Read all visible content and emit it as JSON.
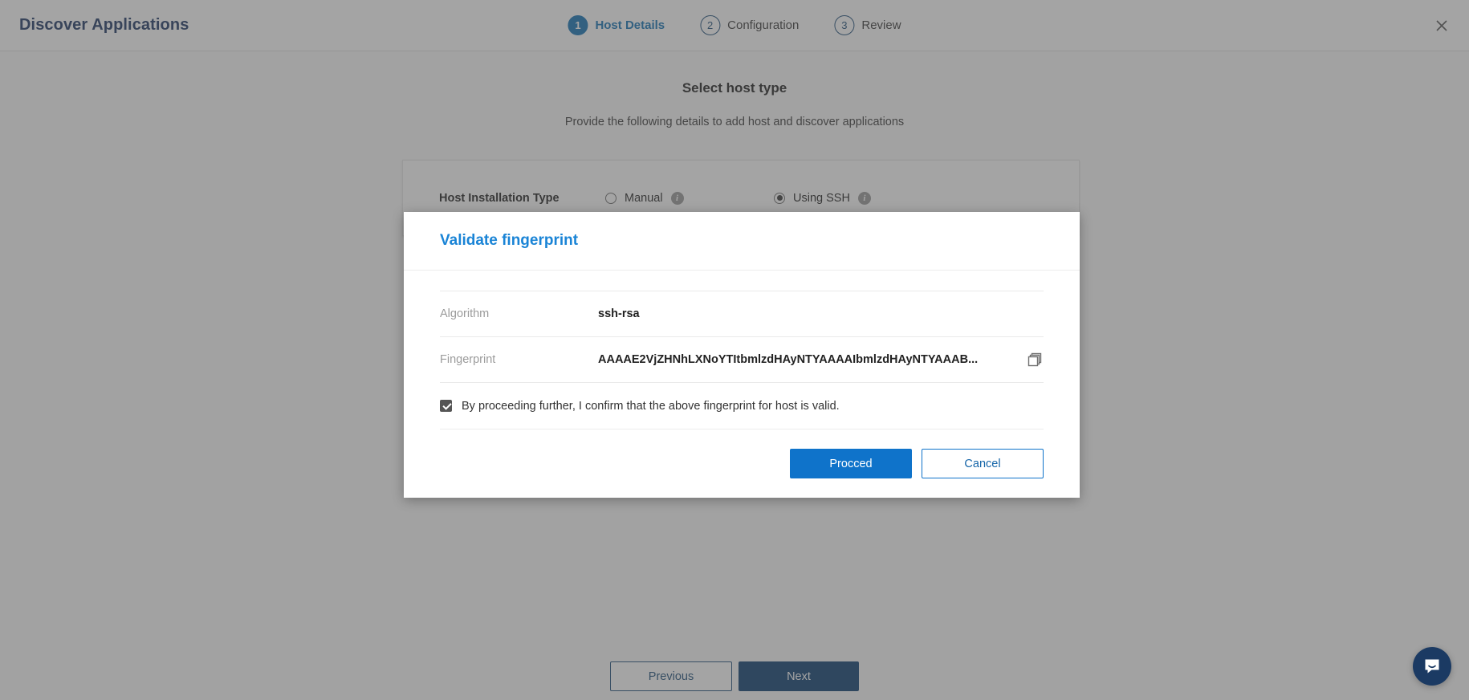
{
  "appbar": {
    "title": "Discover Applications",
    "close_icon": "close-icon",
    "steps": [
      {
        "number": "1",
        "label": "Host Details",
        "state": "active"
      },
      {
        "number": "2",
        "label": "Configuration",
        "state": "idle"
      },
      {
        "number": "3",
        "label": "Review",
        "state": "idle"
      }
    ]
  },
  "page": {
    "title": "Select host type",
    "subtitle": "Provide the following details to add host and discover applications",
    "host_card": {
      "label": "Host Installation Type",
      "options": [
        {
          "label": "Manual",
          "selected": false,
          "info_icon": "info-icon"
        },
        {
          "label": "Using SSH",
          "selected": true,
          "info_icon": "info-icon"
        }
      ]
    },
    "nav": {
      "previous_label": "Previous",
      "next_label": "Next"
    },
    "chat_icon": "chat-bubble-icon"
  },
  "modal": {
    "title": "Validate fingerprint",
    "rows": [
      {
        "label": "Algorithm",
        "value": "ssh-rsa"
      },
      {
        "label": "Fingerprint",
        "value": "AAAAE2VjZHNhLXNoYTItbmlzdHAyNTYAAAAIbmlzdHAyNTYAAAB..."
      }
    ],
    "copy_icon": "copy-icon",
    "confirm": {
      "checked": true,
      "text": "By proceeding further, I confirm that the above fingerprint for host is valid."
    },
    "proceed_label": "Procced",
    "cancel_label": "Cancel"
  },
  "colors": {
    "brand_dark": "#1f3864",
    "accent_blue": "#0f73ca",
    "step_active": "#1271b5",
    "next_button": "#0b3d70"
  }
}
